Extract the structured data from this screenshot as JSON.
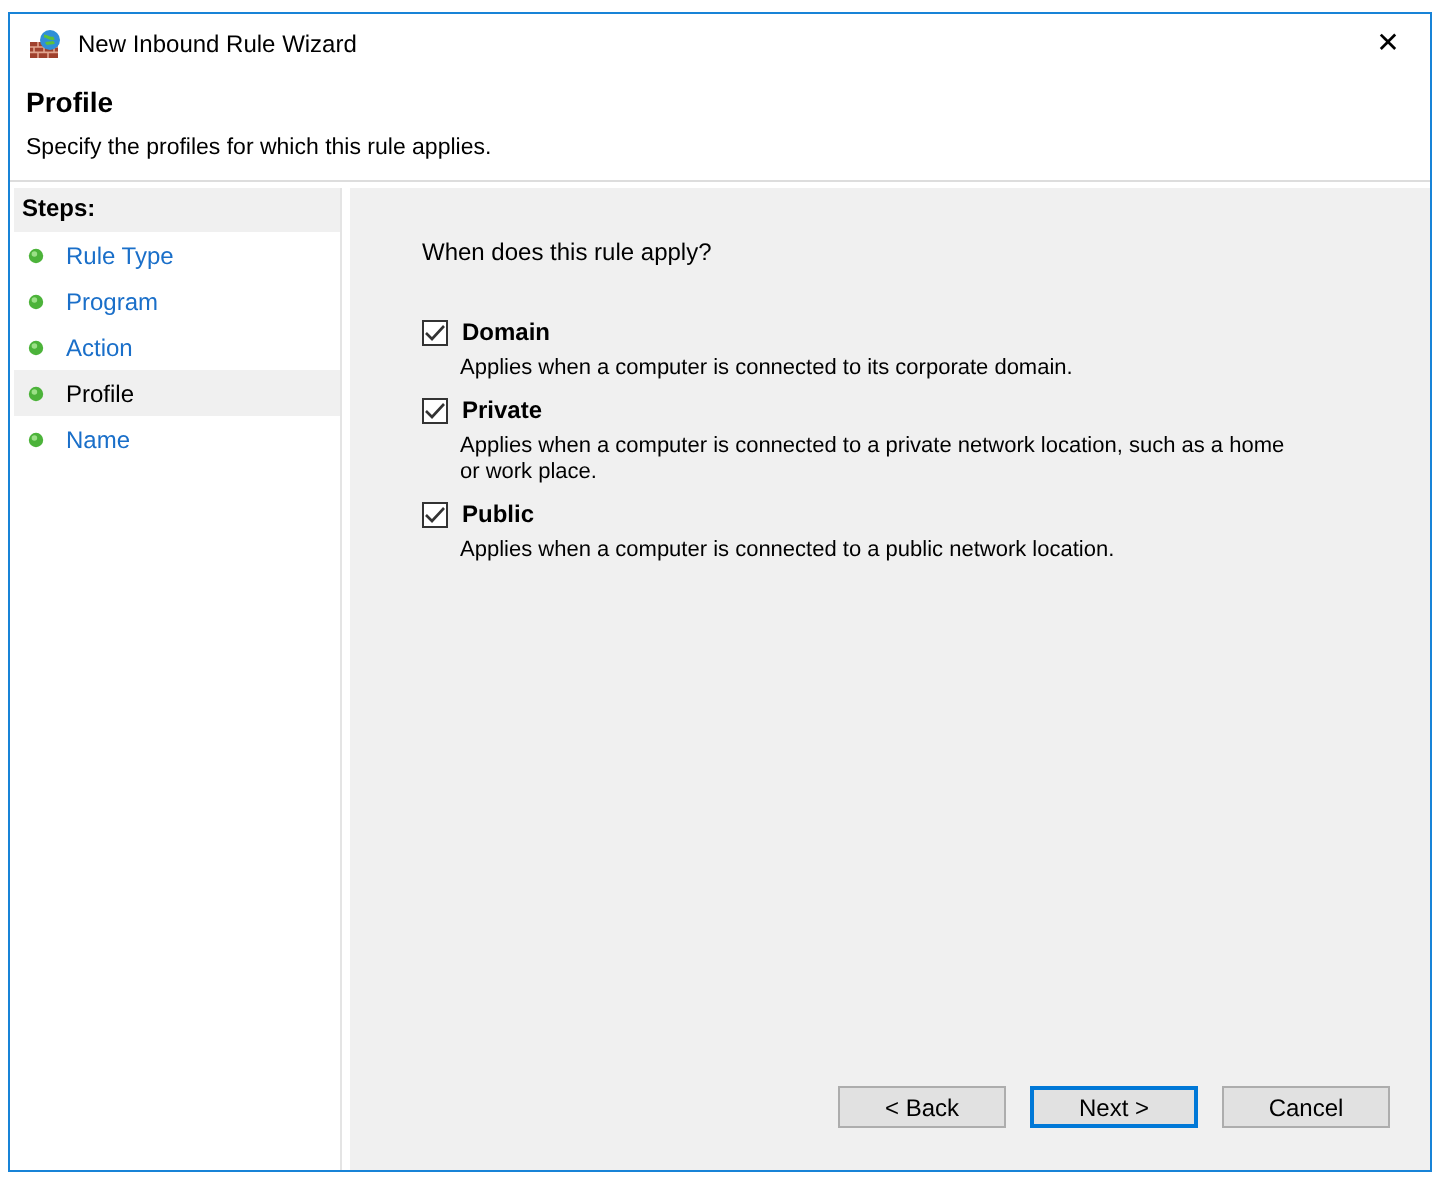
{
  "window": {
    "title": "New Inbound Rule Wizard",
    "close": "✕"
  },
  "header": {
    "title": "Profile",
    "subtitle": "Specify the profiles for which this rule applies."
  },
  "steps": {
    "title": "Steps:",
    "items": [
      {
        "label": "Rule Type",
        "selected": false
      },
      {
        "label": "Program",
        "selected": false
      },
      {
        "label": "Action",
        "selected": false
      },
      {
        "label": "Profile",
        "selected": true
      },
      {
        "label": "Name",
        "selected": false
      }
    ]
  },
  "question": "When does this rule apply?",
  "profiles": [
    {
      "label": "Domain",
      "description": "Applies when a computer is connected to its corporate domain.",
      "checked": true
    },
    {
      "label": "Private",
      "description": "Applies when a computer is connected to a private network location, such as a home or work place.",
      "checked": true
    },
    {
      "label": "Public",
      "description": "Applies when a computer is connected to a public network location.",
      "checked": true
    }
  ],
  "buttons": [
    {
      "label": "< Back",
      "default": false
    },
    {
      "label": "Next >",
      "default": true
    },
    {
      "label": "Cancel",
      "default": false
    }
  ]
}
